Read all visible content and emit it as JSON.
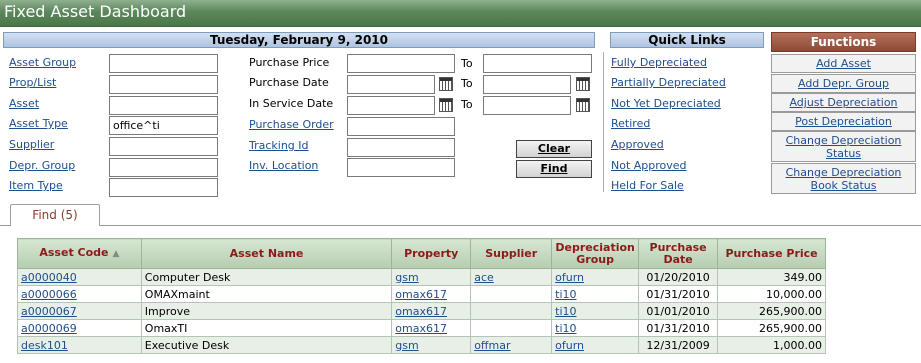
{
  "app": {
    "title": "Fixed Asset Dashboard"
  },
  "search": {
    "date_header": "Tuesday, February 9, 2010",
    "left_labels": [
      "Asset Group",
      "Prop/List",
      "Asset",
      "Asset Type",
      "Supplier",
      "Depr. Group",
      "Item Type"
    ],
    "asset_type_value": "office^ti",
    "mid_labels": [
      "Purchase Price",
      "Purchase Date",
      "In Service Date",
      "Purchase Order",
      "Tracking Id",
      "Inv. Location"
    ],
    "to_label": "To",
    "clear_label": "Clear",
    "find_label": "Find"
  },
  "quick_links": {
    "header": "Quick Links",
    "items": [
      "Fully Depreciated",
      "Partially Depreciated",
      "Not Yet Depreciated",
      "Retired",
      "Approved",
      "Not Approved",
      "Held For Sale"
    ]
  },
  "functions": {
    "header": "Functions",
    "items": [
      "Add Asset",
      "Add Depr. Group",
      "Adjust Depreciation",
      "Post Depreciation",
      "Change Depreciation Status",
      "Change Depreciation Book Status"
    ]
  },
  "results": {
    "tab_label": "Find (5)",
    "columns": [
      "Asset Code",
      "Asset Name",
      "Property",
      "Supplier",
      "Depreciation Group",
      "Purchase Date",
      "Purchase Price"
    ],
    "rows": [
      [
        "a0000040",
        "Computer Desk",
        "gsm",
        "ace",
        "ofurn",
        "01/20/2010",
        "349.00"
      ],
      [
        "a0000066",
        "OMAXmaint",
        "omax617",
        "",
        "ti10",
        "01/31/2010",
        "10,000.00"
      ],
      [
        "a0000067",
        "Improve",
        "omax617",
        "",
        "ti10",
        "01/01/2010",
        "265,900.00"
      ],
      [
        "a0000069",
        "OmaxTI",
        "omax617",
        "",
        "ti10",
        "01/31/2010",
        "265,900.00"
      ],
      [
        "desk101",
        "Executive Desk",
        "gsm",
        "offmar",
        "ofurn",
        "12/31/2009",
        "1,000.00"
      ]
    ]
  }
}
